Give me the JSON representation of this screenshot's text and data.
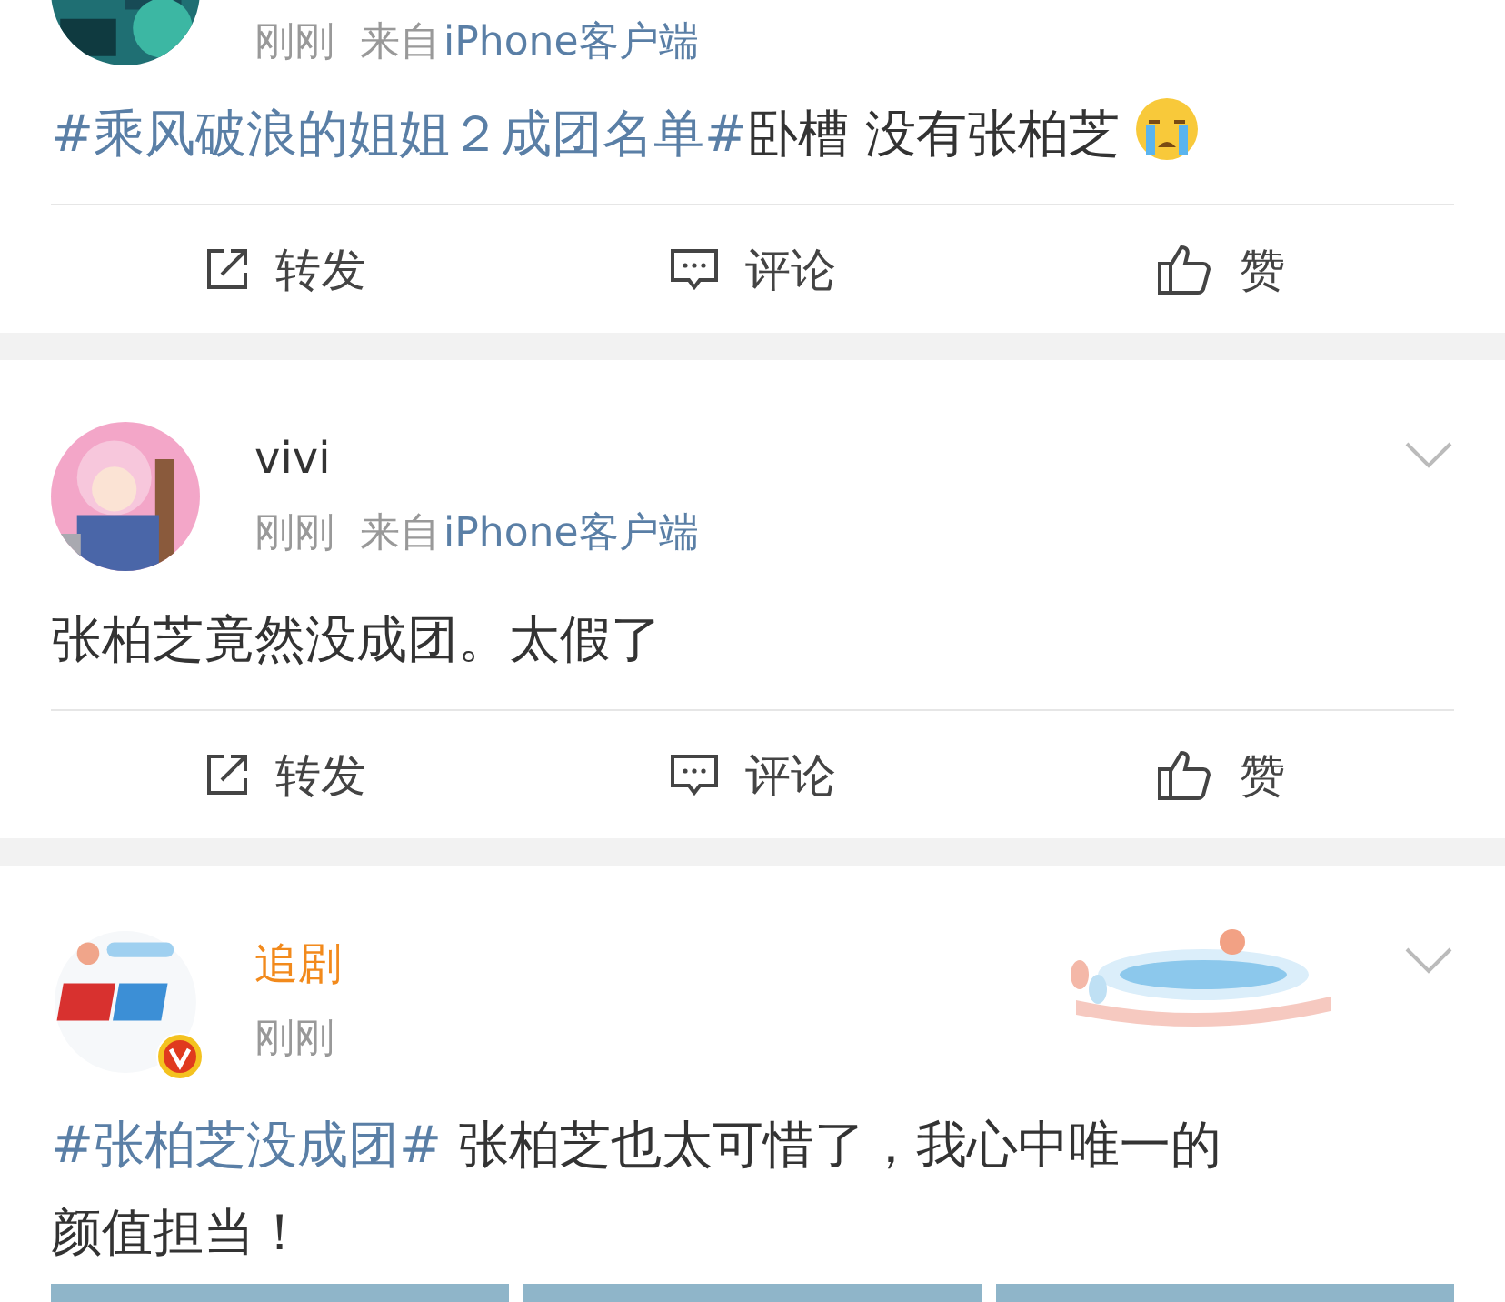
{
  "posts": [
    {
      "avatar": {
        "kind": "picture"
      },
      "time": "刚刚",
      "source_prefix": "来自",
      "source": "iPhone客户端",
      "has_menu": false,
      "segments": [
        {
          "kind": "tag",
          "text": "#乘风破浪的姐姐２成团名单#"
        },
        {
          "kind": "plain",
          "text": "卧槽 没有张柏芝"
        },
        {
          "kind": "emoji"
        }
      ],
      "actions": [
        {
          "kind": "repost",
          "label": "转发"
        },
        {
          "kind": "comment",
          "label": "评论"
        },
        {
          "kind": "like",
          "label": "赞"
        }
      ]
    },
    {
      "avatar": {
        "kind": "picture"
      },
      "author": "vivi",
      "time": "刚刚",
      "source_prefix": "来自",
      "source": "iPhone客户端",
      "has_menu": true,
      "segments": [
        {
          "kind": "plain",
          "text": "张柏芝竟然没成团。太假了"
        }
      ],
      "actions": [
        {
          "kind": "repost",
          "label": "转发"
        },
        {
          "kind": "comment",
          "label": "评论"
        },
        {
          "kind": "like",
          "label": "赞"
        }
      ]
    },
    {
      "avatar": {
        "kind": "picture"
      },
      "verified": true,
      "author": "追剧",
      "time": "刚刚",
      "has_menu": true,
      "sticker": {
        "kind": "picture"
      },
      "segments": [
        {
          "kind": "tag",
          "text": "#张柏芝没成团#"
        },
        {
          "kind": "plain",
          "text": " 张柏芝也太可惜了，我心中唯一的颜值担当！"
        }
      ],
      "images": [
        {
          "kind": "picture"
        },
        {
          "kind": "picture"
        },
        {
          "kind": "picture"
        }
      ]
    }
  ]
}
